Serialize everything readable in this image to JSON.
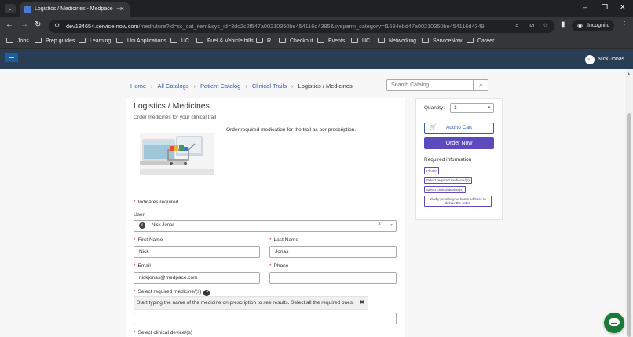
{
  "browser": {
    "tab_title": "Logistics / Medicines - Medpace",
    "tab_dropdown_icon": "chevron-down-icon",
    "new_tab_label": "+",
    "url_host": "dev184654.service-now.com",
    "url_path": "/medfuture?id=sc_cat_item&sys_id=3dc2c2f547a00210350be454116d4385&sysparm_category=f1694ebd47a00210350be454116d4349",
    "incognito_label": "Incognito",
    "bookmarks": [
      "Jobs",
      "Prep guides",
      "Learning",
      "Uni Applications",
      "UC",
      "Fuel & Vehicle bills",
      "R",
      "Checkout",
      "Events",
      "UC",
      "Networking",
      "ServiceNow",
      "Career"
    ]
  },
  "header": {
    "avatar_initials": "NJ",
    "user_name": "Nick Jonas"
  },
  "breadcrumb": {
    "items": [
      "Home",
      "All Catalogs",
      "Patient Catalog",
      "Clinical Trails"
    ],
    "current": "Logistics / Medicines"
  },
  "search": {
    "placeholder": "Search Catalog"
  },
  "item": {
    "title": "Logistics / Medicines",
    "subtitle": "Order medicines for your clinical trail",
    "description": "Order required medication for the trail as per prescription."
  },
  "form": {
    "required_note": "Indicates required",
    "user_label": "User",
    "user_value": "Nick Jonas",
    "first_name_label": "First Name",
    "first_name_value": "Nick",
    "last_name_label": "Last Name",
    "last_name_value": "Jonas",
    "email_label": "Email",
    "email_value": "nickjonas@medpace.com",
    "phone_label": "Phone",
    "phone_value": "",
    "medicine_label": "Select required medicine/(s)",
    "medicine_instruction": "Start typing the name of the medicine on prescription to see results. Select all the required ones.",
    "device_label": "Select clinical device/(s)"
  },
  "order_panel": {
    "quantity_label": "Quantity:",
    "quantity_value": "1",
    "add_to_cart_label": "Add to Cart",
    "order_now_label": "Order Now",
    "required_info_title": "Required information",
    "required_items": [
      "Phone",
      "Select required medicine/(s)",
      "Select clinical device/(s)",
      "Kindly provide your home address to deliver the order."
    ]
  },
  "colors": {
    "primary_button": "#5b4bbf",
    "link": "#2e5fa8",
    "header_bg": "#293e55",
    "required_star": "#c83c3c",
    "chat_button": "#1a7a38"
  }
}
